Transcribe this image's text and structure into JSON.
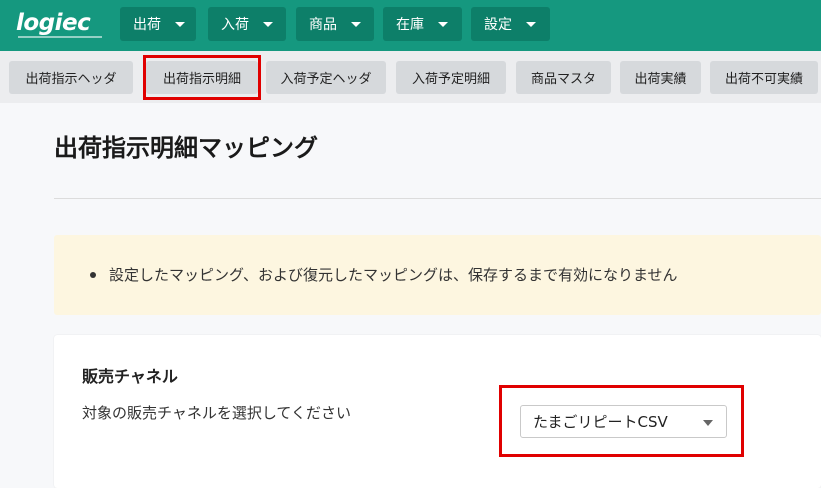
{
  "brand": {
    "logo": "logiec"
  },
  "menus": [
    {
      "label": "出荷"
    },
    {
      "label": "入荷"
    },
    {
      "label": "商品"
    },
    {
      "label": "在庫"
    },
    {
      "label": "設定"
    }
  ],
  "tabs": [
    {
      "label": "出荷指示ヘッダ"
    },
    {
      "label": "出荷指示明細"
    },
    {
      "label": "入荷予定ヘッダ"
    },
    {
      "label": "入荷予定明細"
    },
    {
      "label": "商品マスタ"
    },
    {
      "label": "出荷実績"
    },
    {
      "label": "出荷不可実績"
    }
  ],
  "active_tab": "出荷指示明細",
  "page": {
    "title": "出荷指示明細マッピング",
    "notice": "設定したマッピング、および復元したマッピングは、保存するまで有効になりません"
  },
  "channel": {
    "title": "販売チャネル",
    "description": "対象の販売チャネルを選択してください",
    "selected": "たまごリピートCSV"
  },
  "colors": {
    "header": "#15987f",
    "menu": "#0d7f69",
    "highlight": "#e00000",
    "notice_bg": "#fdf6e0"
  }
}
